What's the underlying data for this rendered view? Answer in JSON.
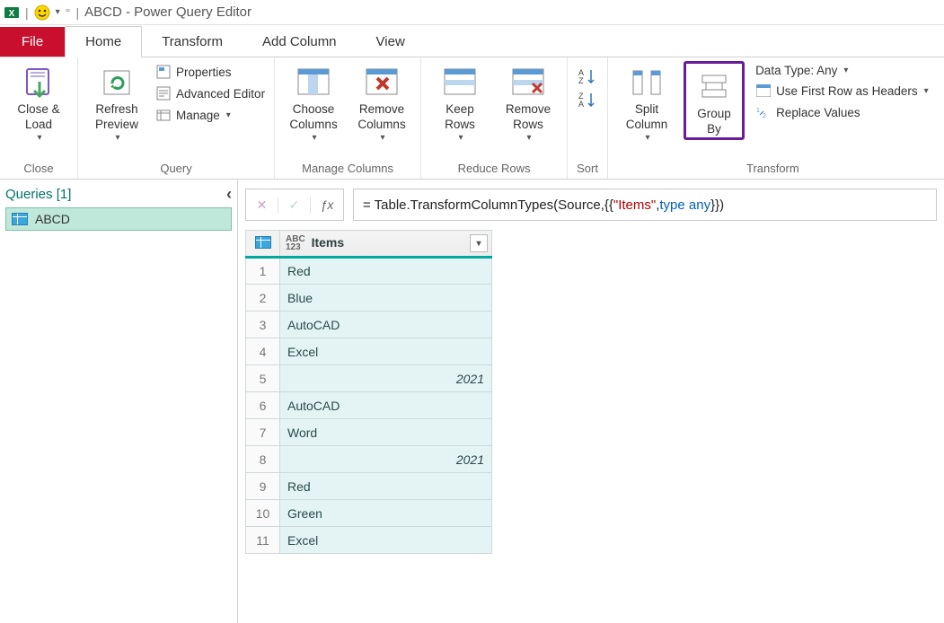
{
  "titlebar": {
    "app_title": "ABCD - Power Query Editor"
  },
  "tabs": {
    "file": "File",
    "home": "Home",
    "transform": "Transform",
    "add_column": "Add Column",
    "view": "View"
  },
  "ribbon": {
    "close": {
      "close_load": "Close &\nLoad",
      "group": "Close"
    },
    "query": {
      "refresh": "Refresh\nPreview",
      "properties": "Properties",
      "advanced": "Advanced Editor",
      "manage": "Manage",
      "group": "Query"
    },
    "manage_cols": {
      "choose": "Choose\nColumns",
      "remove": "Remove\nColumns",
      "group": "Manage Columns"
    },
    "reduce": {
      "keep": "Keep\nRows",
      "remove": "Remove\nRows",
      "group": "Reduce Rows"
    },
    "sort": {
      "group": "Sort"
    },
    "transform_grp": {
      "split": "Split\nColumn",
      "groupby": "Group\nBy",
      "datatype_label": "Data Type: Any",
      "first_row": "Use First Row as Headers",
      "replace": "Replace Values",
      "group": "Transform"
    }
  },
  "queries": {
    "header": "Queries [1]",
    "item": "ABCD"
  },
  "formula": {
    "prefix": "= Table.TransformColumnTypes(Source,{{",
    "str": "\"Items\"",
    "mid": ", ",
    "kw": "type any",
    "suffix": "}})"
  },
  "grid": {
    "col_header": "Items",
    "type_badge": "ABC\n123",
    "rows": [
      {
        "n": "1",
        "v": "Red"
      },
      {
        "n": "2",
        "v": "Blue"
      },
      {
        "n": "3",
        "v": "AutoCAD"
      },
      {
        "n": "4",
        "v": "Excel"
      },
      {
        "n": "5",
        "v": "2021",
        "num": true
      },
      {
        "n": "6",
        "v": "AutoCAD"
      },
      {
        "n": "7",
        "v": "Word"
      },
      {
        "n": "8",
        "v": "2021",
        "num": true
      },
      {
        "n": "9",
        "v": "Red"
      },
      {
        "n": "10",
        "v": "Green"
      },
      {
        "n": "11",
        "v": "Excel"
      }
    ]
  }
}
